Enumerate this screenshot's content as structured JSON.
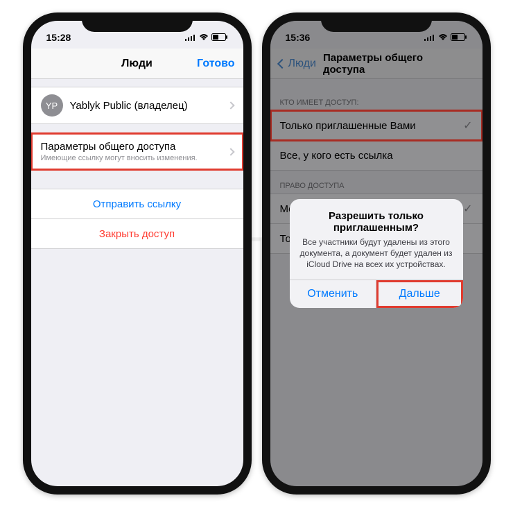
{
  "watermark": "ЯБЛЫК",
  "left": {
    "time": "15:28",
    "nav_title": "Люди",
    "nav_done": "Готово",
    "owner_initials": "YP",
    "owner_name": "Yablyk Public (владелец)",
    "share_params_title": "Параметры общего доступа",
    "share_params_sub": "Имеющие ссылку могут вносить изменения.",
    "send_link": "Отправить ссылку",
    "close_access": "Закрыть доступ"
  },
  "right": {
    "time": "15:36",
    "nav_back": "Люди",
    "nav_title": "Параметры общего доступа",
    "section_who": "КТО ИМЕЕТ ДОСТУП:",
    "opt_invited": "Только приглашенные Вами",
    "opt_anyone": "Все, у кого есть ссылка",
    "section_perm": "ПРАВО ДОСТУПА",
    "opt_edit": "Можно вносить изменения",
    "opt_view": "Только просмотр",
    "alert_title": "Разрешить только приглашенным?",
    "alert_msg": "Все участники будут удалены из этого документа, а документ будет удален из iCloud Drive на всех их устройствах.",
    "alert_cancel": "Отменить",
    "alert_continue": "Дальше"
  }
}
